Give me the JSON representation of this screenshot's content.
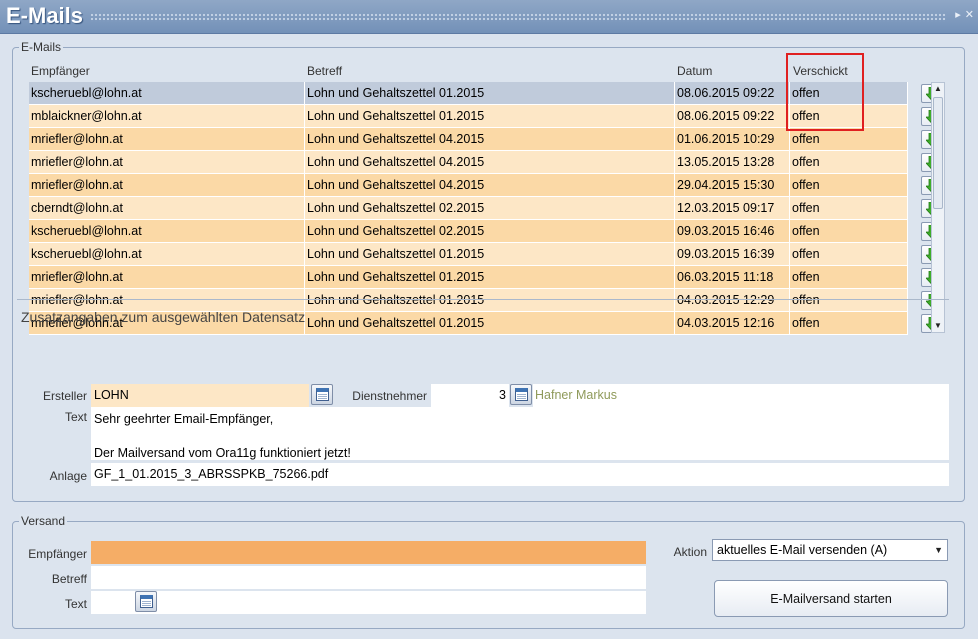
{
  "window": {
    "title": "E-Mails",
    "icons": [
      "pin-icon",
      "close-icon"
    ]
  },
  "emails_group": {
    "legend": "E-Mails",
    "columns": {
      "recipient": "Empfänger",
      "subject": "Betreff",
      "date": "Datum",
      "sent": "Verschickt"
    },
    "rows": [
      {
        "recipient": "kscheruebl@lohn.at",
        "subject": "Lohn und Gehaltszettel 01.2015",
        "date": "08.06.2015 09:22",
        "sent": "offen"
      },
      {
        "recipient": "mblaickner@lohn.at",
        "subject": "Lohn und Gehaltszettel 01.2015",
        "date": "08.06.2015 09:22",
        "sent": "offen"
      },
      {
        "recipient": "mriefler@lohn.at",
        "subject": "Lohn und Gehaltszettel 04.2015",
        "date": "01.06.2015 10:29",
        "sent": "offen"
      },
      {
        "recipient": "mriefler@lohn.at",
        "subject": "Lohn und Gehaltszettel 04.2015",
        "date": "13.05.2015 13:28",
        "sent": "offen"
      },
      {
        "recipient": "mriefler@lohn.at",
        "subject": "Lohn und Gehaltszettel 04.2015",
        "date": "29.04.2015 15:30",
        "sent": "offen"
      },
      {
        "recipient": "cberndt@lohn.at",
        "subject": "Lohn und Gehaltszettel 02.2015",
        "date": "12.03.2015 09:17",
        "sent": "offen"
      },
      {
        "recipient": "kscheruebl@lohn.at",
        "subject": "Lohn und Gehaltszettel 02.2015",
        "date": "09.03.2015 16:46",
        "sent": "offen"
      },
      {
        "recipient": "kscheruebl@lohn.at",
        "subject": "Lohn und Gehaltszettel 01.2015",
        "date": "09.03.2015 16:39",
        "sent": "offen"
      },
      {
        "recipient": "mriefler@lohn.at",
        "subject": "Lohn und Gehaltszettel 01.2015",
        "date": "06.03.2015 11:18",
        "sent": "offen"
      },
      {
        "recipient": "mriefler@lohn.at",
        "subject": "Lohn und Gehaltszettel 01.2015",
        "date": "04.03.2015 12:29",
        "sent": "offen"
      },
      {
        "recipient": "mriefler@lohn.at",
        "subject": "Lohn und Gehaltszettel 01.2015",
        "date": "04.03.2015 12:16",
        "sent": "offen"
      }
    ],
    "details": {
      "title": "Zusatzangaben zum ausgewählten Datensatz",
      "creator_label": "Ersteller",
      "creator_value": "LOHN",
      "employee_label": "Dienstnehmer",
      "employee_number": "3",
      "employee_name": "Hafner Markus",
      "text_label": "Text",
      "text_line1": "Sehr geehrter Email-Empfänger,",
      "text_line2": "Der Mailversand vom Ora11g funktioniert jetzt!",
      "attachment_label": "Anlage",
      "attachment_value": "GF_1_01.2015_3_ABRSSPKB_75266.pdf"
    }
  },
  "dispatch_group": {
    "legend": "Versand",
    "recipient_label": "Empfänger",
    "recipient_value": "",
    "subject_label": "Betreff",
    "subject_value": "",
    "text_label": "Text",
    "action_label": "Aktion",
    "action_value": "aktuelles E-Mail versenden (A)",
    "start_button": "E-Mailversand starten"
  },
  "colors": {
    "row_bg": "#fde7c6",
    "row_selected": "#c0cbdb",
    "recipient_required": "#f5ad66",
    "highlight_frame": "#e02020"
  }
}
